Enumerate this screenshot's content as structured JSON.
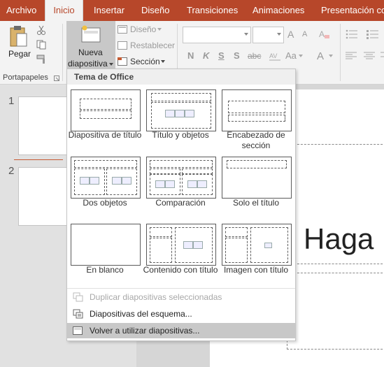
{
  "tabs": [
    "Archivo",
    "Inicio",
    "Insertar",
    "Diseño",
    "Transiciones",
    "Animaciones",
    "Presentación con"
  ],
  "ribbon": {
    "paste_label": "Pegar",
    "clipboard_group": "Portapapeles",
    "new_slide_line1": "Nueva",
    "new_slide_line2": "diapositiva",
    "layout_label": "Diseño",
    "reset_label": "Restablecer",
    "section_label": "Sección",
    "bold": "N",
    "italic": "K",
    "underline": "S",
    "strike": "S",
    "spacing": "abc",
    "case": "Aa",
    "font_color": "A",
    "grow": "A",
    "shrink": "A"
  },
  "thumbnails": [
    {
      "number": "1"
    },
    {
      "number": "2"
    }
  ],
  "slide": {
    "placeholder_text": "Haga"
  },
  "dropdown": {
    "header": "Tema de Office",
    "layouts": [
      {
        "label": "Diapositiva de título"
      },
      {
        "label": "Título y objetos"
      },
      {
        "label": "Encabezado de sección"
      },
      {
        "label": "Dos objetos"
      },
      {
        "label": "Comparación"
      },
      {
        "label": "Solo el título"
      },
      {
        "label": "En blanco"
      },
      {
        "label": "Contenido con título"
      },
      {
        "label": "Imagen con título"
      }
    ],
    "menu": [
      {
        "label": "Duplicar diapositivas seleccionadas",
        "state": "disabled"
      },
      {
        "label": "Diapositivas del esquema...",
        "state": "normal"
      },
      {
        "label": "Volver a utilizar diapositivas...",
        "state": "hover"
      }
    ]
  },
  "colors": {
    "accent": "#b7472a",
    "ribbon_bg": "#f3f3f3",
    "hover": "#c8c8c8"
  }
}
